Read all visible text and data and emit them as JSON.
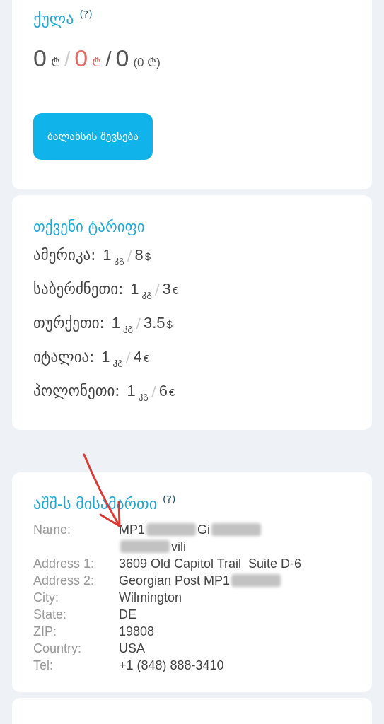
{
  "balance_card": {
    "title": "ქულა",
    "help": "(?)",
    "balance": {
      "amount_1": "0",
      "currency_1": "₾",
      "separator_1": "/",
      "amount_2": "0",
      "currency_2": "₾",
      "separator_2": "/",
      "amount_3": "0",
      "note": "(0 ₾)"
    },
    "button": "ბალანსის შევსება"
  },
  "tariff_card": {
    "title": "თქვენი ტარიფი",
    "rows": [
      {
        "country": "ამერიკა:",
        "weight": "1",
        "unit": "კგ",
        "separator": "/",
        "price": "8",
        "currency": "$"
      },
      {
        "country": "საბერძნეთი:",
        "weight": "1",
        "unit": "კგ",
        "separator": "/",
        "price": "3",
        "currency": "€"
      },
      {
        "country": "თურქეთი:",
        "weight": "1",
        "unit": "კგ",
        "separator": "/",
        "price": "3.5",
        "currency": "$"
      },
      {
        "country": "იტალია:",
        "weight": "1",
        "unit": "კგ",
        "separator": "/",
        "price": "4",
        "currency": "€"
      },
      {
        "country": "პოლონეთი:",
        "weight": "1",
        "unit": "კგ",
        "separator": "/",
        "price": "6",
        "currency": "€"
      }
    ]
  },
  "address_card": {
    "title": "აშშ-ს მისამართი",
    "help": "(?)",
    "rows": [
      {
        "label": "Name:",
        "lines": [
          [
            {
              "kind": "text",
              "text": "MP1"
            },
            {
              "kind": "redacted"
            },
            {
              "kind": "text",
              "text": "Gi"
            },
            {
              "kind": "redacted"
            }
          ],
          [
            {
              "kind": "redacted"
            },
            {
              "kind": "text",
              "text": "vili"
            }
          ]
        ]
      },
      {
        "label": "Address 1:",
        "lines": [
          [
            {
              "kind": "text",
              "text": "3609 Old Capitol Trail  Suite D-6"
            }
          ]
        ]
      },
      {
        "label": "Address 2:",
        "lines": [
          [
            {
              "kind": "text",
              "text": "Georgian Post MP1"
            },
            {
              "kind": "redacted"
            }
          ]
        ]
      },
      {
        "label": "City:",
        "lines": [
          [
            {
              "kind": "text",
              "text": "Wilmington"
            }
          ]
        ]
      },
      {
        "label": "State:",
        "lines": [
          [
            {
              "kind": "text",
              "text": "DE"
            }
          ]
        ]
      },
      {
        "label": "ZIP:",
        "lines": [
          [
            {
              "kind": "text",
              "text": "19808"
            }
          ]
        ]
      },
      {
        "label": "Country:",
        "lines": [
          [
            {
              "kind": "text",
              "text": "USA"
            }
          ]
        ]
      },
      {
        "label": "Tel:",
        "lines": [
          [
            {
              "kind": "text",
              "text": "+1 (848) 888-3410"
            }
          ]
        ]
      }
    ]
  }
}
